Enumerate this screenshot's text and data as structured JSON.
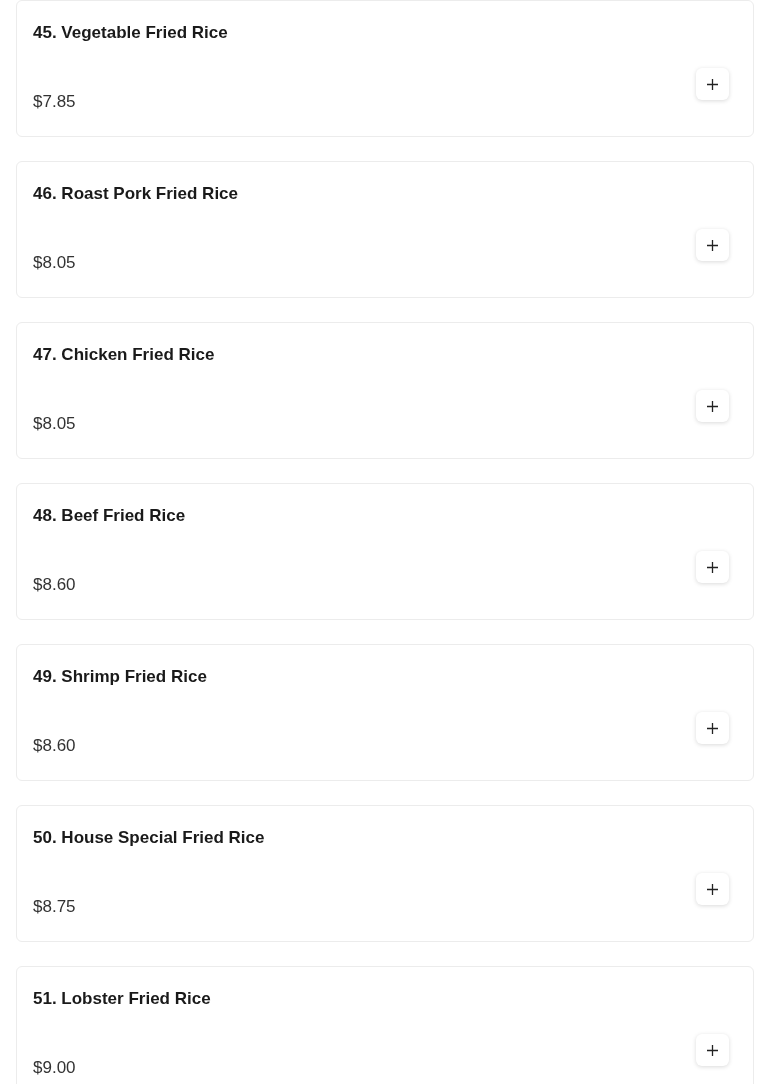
{
  "menu_items": [
    {
      "name": "45. Vegetable Fried Rice",
      "price": "$7.85"
    },
    {
      "name": "46. Roast Pork Fried Rice",
      "price": "$8.05"
    },
    {
      "name": "47. Chicken Fried Rice",
      "price": "$8.05"
    },
    {
      "name": "48. Beef Fried Rice",
      "price": "$8.60"
    },
    {
      "name": "49. Shrimp Fried Rice",
      "price": "$8.60"
    },
    {
      "name": "50. House Special Fried Rice",
      "price": "$8.75"
    },
    {
      "name": "51. Lobster Fried Rice",
      "price": "$9.00"
    }
  ]
}
